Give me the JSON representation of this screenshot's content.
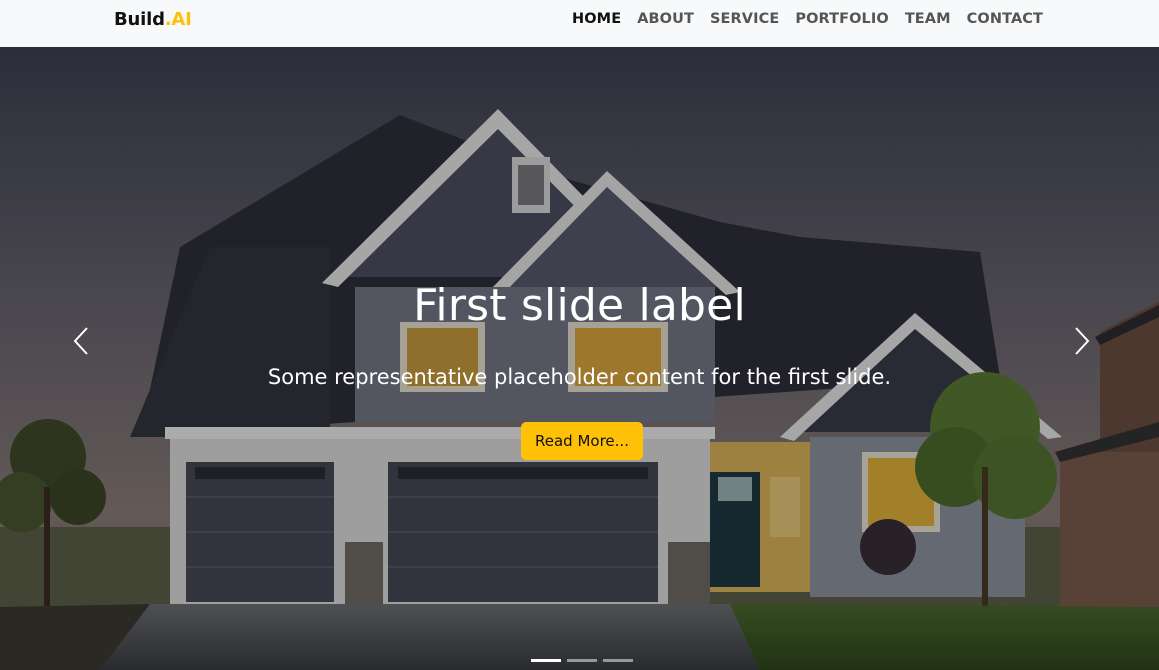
{
  "brand": {
    "name": "Build",
    "dot_suffix": ".AI"
  },
  "nav": {
    "items": [
      {
        "label": "HOME",
        "active": true
      },
      {
        "label": "ABOUT"
      },
      {
        "label": "SERVICE"
      },
      {
        "label": "PORTFOLIO"
      },
      {
        "label": "TEAM"
      },
      {
        "label": "CONTACT"
      }
    ]
  },
  "hero": {
    "title": "First slide label",
    "subtitle": "Some representative placeholder content for the first slide.",
    "button_label": "Read More...",
    "slide_count": 3,
    "active_slide": 1,
    "prev_icon": "chevron-left-icon",
    "next_icon": "chevron-right-icon"
  },
  "colors": {
    "accent": "#ffc107",
    "navbar_bg": "#f8f9fa",
    "nav_active": "#111111",
    "nav_text": "#555555"
  }
}
